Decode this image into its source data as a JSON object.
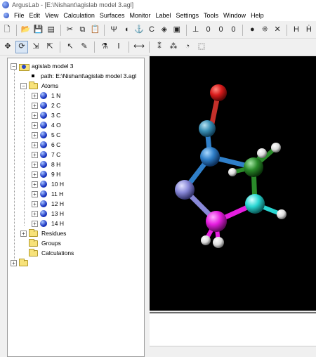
{
  "window": {
    "title": "ArgusLab - [E:\\Nishant\\agislab model 3.agl]"
  },
  "menu": [
    "File",
    "Edit",
    "View",
    "Calculation",
    "Surfaces",
    "Monitor",
    "Label",
    "Settings",
    "Tools",
    "Window",
    "Help"
  ],
  "toolbar1": [
    {
      "name": "new-document-icon",
      "glyph": "🗋"
    },
    {
      "name": "open-folder-icon",
      "glyph": "📂"
    },
    {
      "name": "save-icon",
      "glyph": "💾"
    },
    {
      "name": "print-icon",
      "glyph": "▤"
    },
    {
      "name": "cut-icon",
      "glyph": "✂"
    },
    {
      "name": "copy-icon",
      "glyph": "⧉"
    },
    {
      "name": "paste-icon",
      "glyph": "📋"
    },
    {
      "name": "fork-icon",
      "glyph": "Ψ"
    },
    {
      "name": "bond-order-icon",
      "glyph": "◖"
    },
    {
      "name": "hydrogen-add-icon",
      "glyph": "⚓"
    },
    {
      "name": "chirality-icon",
      "glyph": "C"
    },
    {
      "name": "color-atoms-icon",
      "glyph": "◈"
    },
    {
      "name": "residue-icon",
      "glyph": "▣"
    },
    {
      "name": "measure-distance-icon",
      "glyph": "⊥"
    },
    {
      "name": "bond-single-icon",
      "glyph": "0"
    },
    {
      "name": "bond-double-icon",
      "glyph": "0"
    },
    {
      "name": "bond-triple-icon",
      "glyph": "0"
    },
    {
      "name": "atom-blue-icon",
      "glyph": "●"
    },
    {
      "name": "atom-add-icon",
      "glyph": "⁜"
    },
    {
      "name": "delete-atom-icon",
      "glyph": "✕"
    },
    {
      "name": "add-hydrogens-icon",
      "glyph": "H"
    },
    {
      "name": "hydrogen-edit-icon",
      "glyph": "Ḣ"
    }
  ],
  "toolbar2": [
    {
      "name": "move-icon",
      "glyph": "✥",
      "active": false
    },
    {
      "name": "rotate-icon",
      "glyph": "⟳",
      "active": true
    },
    {
      "name": "select-atom-icon",
      "glyph": "⇲",
      "active": false
    },
    {
      "name": "select-region-icon",
      "glyph": "⇱",
      "active": false
    },
    {
      "name": "pointer-icon",
      "glyph": "↖",
      "active": false
    },
    {
      "name": "draw-pencil-icon",
      "glyph": "✎",
      "active": false
    },
    {
      "name": "builder-icon",
      "glyph": "⚗",
      "active": false
    },
    {
      "name": "text-cursor-icon",
      "glyph": "Ⅰ",
      "active": false
    },
    {
      "name": "bond-line-icon",
      "glyph": "⟷",
      "active": false
    },
    {
      "name": "ball-stick-icon",
      "glyph": "⁑",
      "active": false
    },
    {
      "name": "color-balls-icon",
      "glyph": "⁂",
      "active": false
    },
    {
      "name": "rainbow-icon",
      "glyph": "◔",
      "active": false
    },
    {
      "name": "box-icon",
      "glyph": "⬚",
      "active": false
    }
  ],
  "tree": {
    "root": "agislab model 3",
    "path": "path: E:\\Nishant\\agislab model 3.agl",
    "atoms_label": "Atoms",
    "atoms": [
      "1 N",
      "2 C",
      "3 C",
      "4 O",
      "5 C",
      "6 C",
      "7 C",
      "8 H",
      "9 H",
      "10 H",
      "11 H",
      "12 H",
      "13 H",
      "14 H"
    ],
    "residues": "Residues",
    "groups": "Groups",
    "calculations": "Calculations"
  },
  "colors": {
    "carbon_blue": "#2f7fc9",
    "oxygen": "#d81b1b",
    "nitrogen": "#8888d8",
    "magenta": "#e61ee0",
    "cyan": "#29d6d2",
    "green": "#2a8a2a",
    "hydrogen": "#e8e8e8",
    "viewer_bg": "#000000"
  }
}
